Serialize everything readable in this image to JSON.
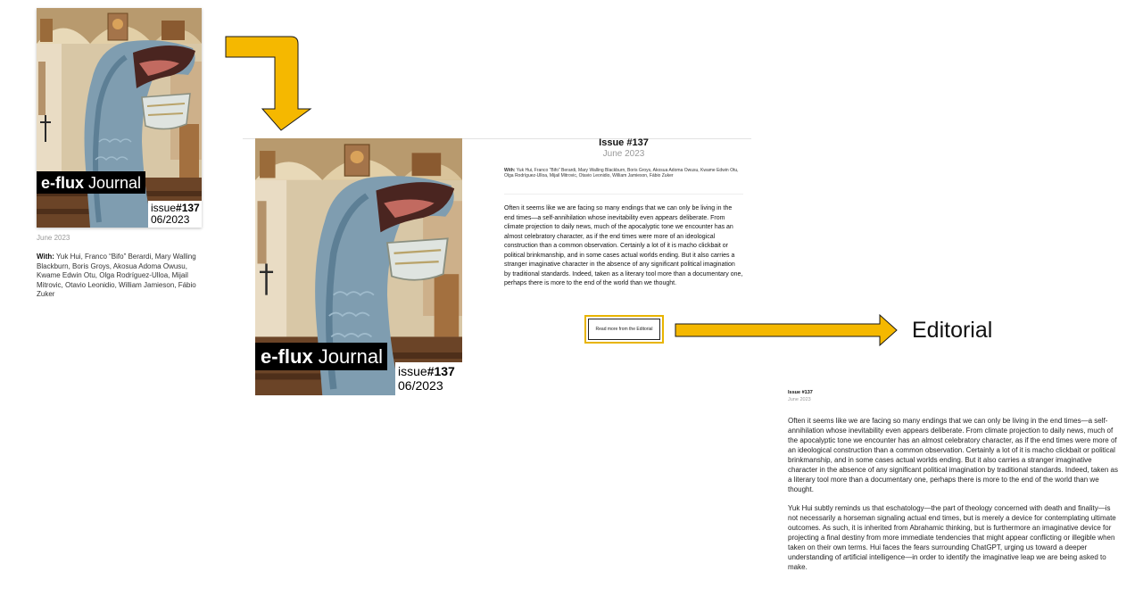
{
  "cover": {
    "brand_bold": "e-flux",
    "brand_light": " Journal",
    "issue_prefix": "issue",
    "issue_number": "#137",
    "issue_date": "06/2023"
  },
  "left_column": {
    "date": "June 2023",
    "with_label": "With:",
    "contributors": " Yuk Hui, Franco “Bifo” Berardi, Mary Walling Blackburn, Boris Groys, Akosua Adoma Owusu, Kwame Edwin Otu, Olga Rodríguez-Ulloa, Mijail Mitrovic, Otavio Leonidio, William Jamieson, Fábio Zuker"
  },
  "issue_page": {
    "title": "Issue #137",
    "date": "June 2023",
    "with_label": "With:",
    "contributors": " Yuk Hui, Franco “Bifo” Berardi, Mary Walling Blackburn, Boris Groys, Akosua Adoma Owusu, Kwame Edwin Otu, Olga Rodríguez-Ulloa, Mijail Mitrovic, Otavio Leonidio, William Jamieson, Fábio Zuker",
    "body": "Often it seems like we are facing so many endings that we can only be living in the end times—a self-annihilation whose inevitability even appears deliberate. From climate projection to daily news, much of the apocalyptic tone we encounter has an almost celebratory character, as if the end times were more of an ideological construction than a common observation. Certainly a lot of it is macho clickbait or political brinkmanship, and in some cases actual worlds ending. But it also carries a stranger imaginative character in the absence of any significant political imagination by traditional standards. Indeed, taken as a literary tool more than a documentary one, perhaps there is more to the end of the world than we thought.",
    "read_more": "Read more from the Editorial"
  },
  "editorial_label": "Editorial",
  "editorial_page": {
    "title": "Issue #137",
    "date": "June 2023",
    "paragraph_1": "Often it seems like we are facing so many endings that we can only be living in the end times—a self-annihilation whose inevitability even appears deliberate. From climate projection to daily news, much of the apocalyptic tone we encounter has an almost celebratory character, as if the end times were more of an ideological construction than a common observation. Certainly a lot of it is macho clickbait or political brinkmanship, and in some cases actual worlds ending. But it also carries a stranger imaginative character in the absence of any significant political imagination by traditional standards. Indeed, taken as a literary tool more than a documentary one, perhaps there is more to the end of the world than we thought.",
    "paragraph_2": "Yuk Hui subtly reminds us that eschatology—the part of theology concerned with death and finality—is not necessarily a horseman signaling actual end times, but is merely a device for contemplating ultimate outcomes. As such, it is inherited from Abrahamic thinking, but is furthermore an imaginative device for projecting a final destiny from more immediate tendencies that might appear conflicting or illegible when taken on their own terms. Hui faces the fears surrounding ChatGPT, urging us toward a deeper understanding of artificial intelligence—in order to identify the imaginative leap we are being asked to make."
  },
  "colors": {
    "arrow_fill": "#f5b800",
    "arrow_stroke": "#1a1a1a",
    "highlight_border": "#e8b400",
    "muted_text": "#999999"
  }
}
